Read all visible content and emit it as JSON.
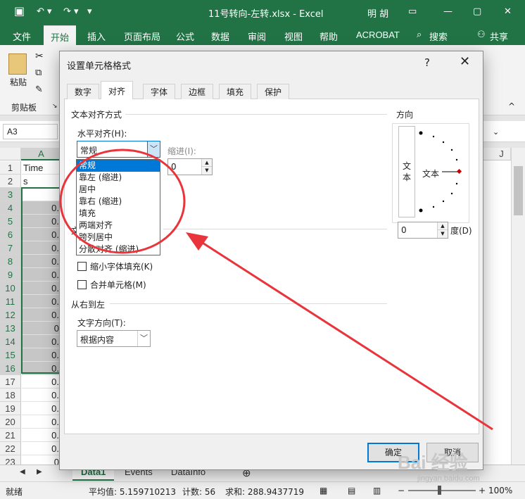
{
  "window": {
    "title": "11号转向-左转.xlsx  -  Excel",
    "user": "明 胡"
  },
  "ribbon": {
    "tabs": [
      "文件",
      "开始",
      "插入",
      "页面布局",
      "公式",
      "数据",
      "审阅",
      "视图",
      "帮助",
      "ACROBAT",
      "搜索",
      "共享"
    ],
    "active_tab": "开始",
    "paste_label": "粘贴",
    "clipboard_label": "剪贴板"
  },
  "name_box": "A3",
  "sheet": {
    "col_a_header": "A",
    "col_j_header": "J",
    "row_numbers": [
      "1",
      "2",
      "3",
      "4",
      "5",
      "6",
      "7",
      "8",
      "9",
      "10",
      "11",
      "12",
      "13",
      "14",
      "15",
      "16",
      "17",
      "18",
      "19",
      "20",
      "21",
      "22",
      "23"
    ],
    "col_a_values": [
      "Time",
      "s",
      "",
      "0.",
      "0.",
      "0.",
      "0.",
      "0.",
      "0.",
      "0.",
      "0.",
      "0.",
      "0",
      "0.",
      "0.",
      "0.",
      "0.",
      "0.",
      "0.",
      "0.",
      "0.",
      "0.",
      "0"
    ]
  },
  "sheet_tabs": [
    "Data1",
    "Events",
    "DataInfo"
  ],
  "status": {
    "ready": "就绪",
    "average": "平均值: 5.159710213",
    "count": "计数: 56",
    "sum": "求和: 288.9437719",
    "zoom": "100%"
  },
  "dialog": {
    "title": "设置单元格格式",
    "help": "?",
    "close": "✕",
    "tabs": [
      "数字",
      "对齐",
      "字体",
      "边框",
      "填充",
      "保护"
    ],
    "active_tab": "对齐",
    "text_align_group": "文本对齐方式",
    "horizontal_label": "水平对齐(H):",
    "horizontal_value": "常规",
    "indent_label": "缩进(I):",
    "indent_value": "0",
    "text_control_group": "文",
    "shrink_label": "缩小字体填充(K)",
    "merge_label": "合并单元格(M)",
    "rtl_group": "从右到左",
    "text_direction_label": "文字方向(T):",
    "text_direction_value": "根据内容",
    "orientation_group": "方向",
    "orientation_vertical_text": "文\n本",
    "orientation_text": "文本",
    "degrees_value": "0",
    "degrees_label": "度(D)",
    "ok": "确定",
    "cancel": "取消"
  },
  "dropdown": {
    "options": [
      "常规",
      "靠左 (缩进)",
      "居中",
      "靠右 (缩进)",
      "填充",
      "两端对齐",
      "跨列居中",
      "分散对齐 (缩进)"
    ],
    "selected_index": 0
  },
  "colors": {
    "excel_green": "#217346",
    "highlight_blue": "#0078d7",
    "annotation_red": "#e8343a"
  },
  "watermark": {
    "brand": "Bai 经验",
    "url": "jingyan.baidu.com"
  }
}
